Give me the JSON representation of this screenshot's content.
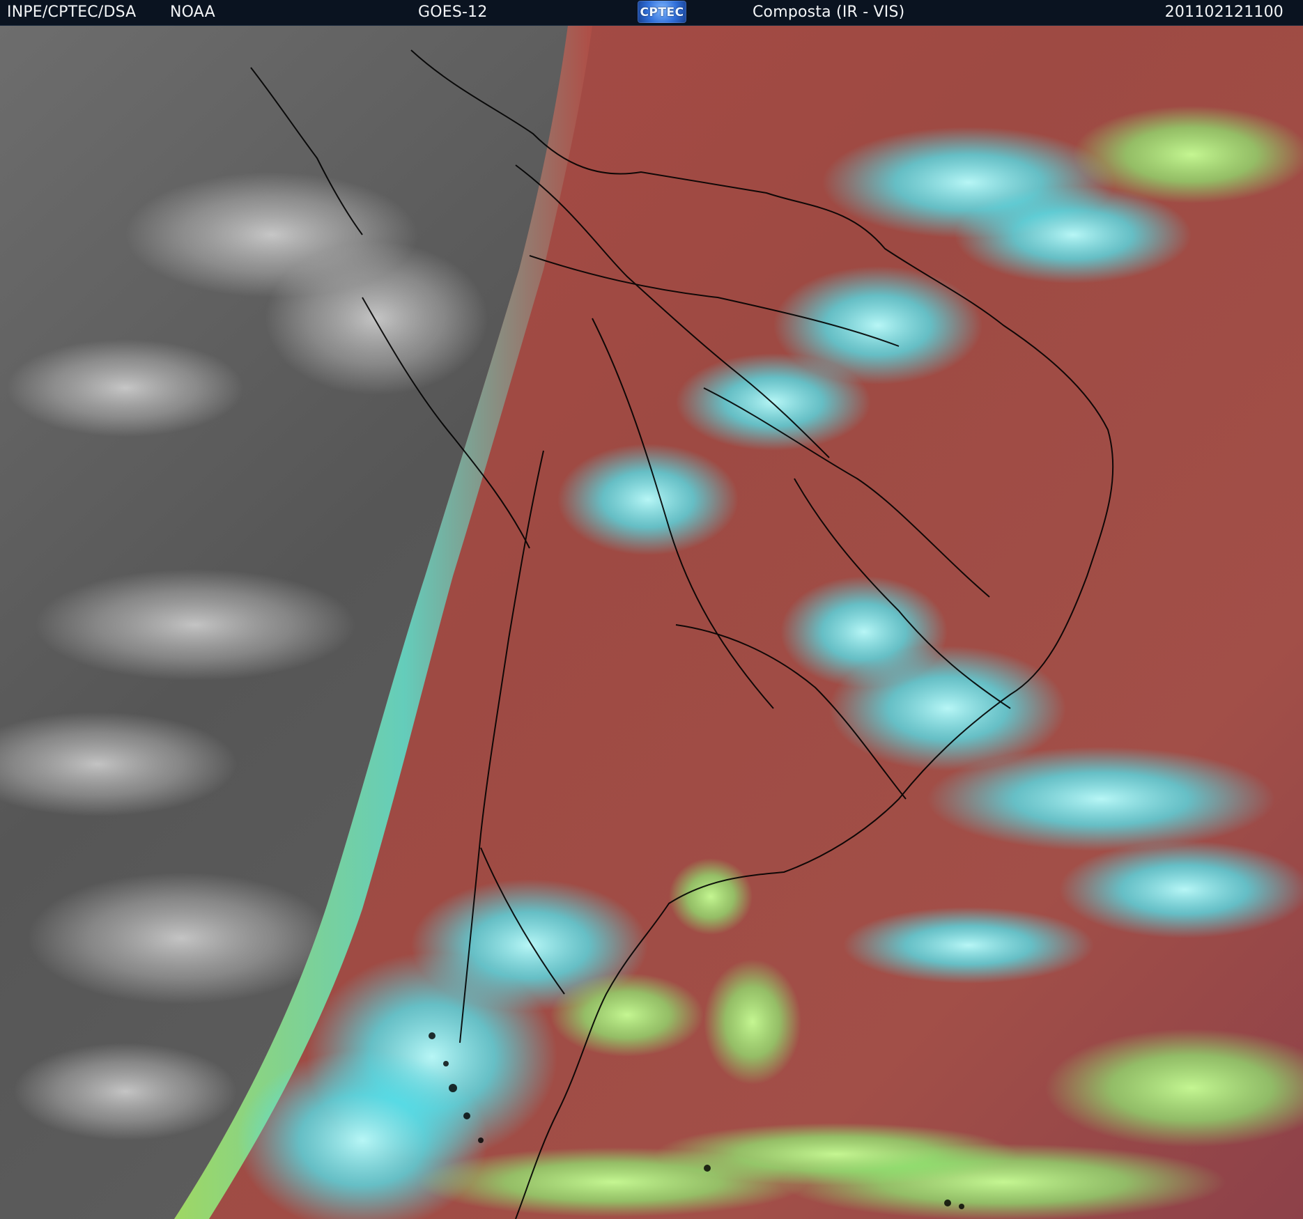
{
  "header": {
    "agency": "INPE/CPTEC/DSA",
    "noaa": "NOAA",
    "satellite": "GOES-12",
    "logo_text": "CPTEC",
    "product": "Composta (IR - VIS)",
    "timestamp": "201102121100"
  },
  "image": {
    "logo_icon": "cptec-logo-icon",
    "colors": {
      "night_gray": "#6d6d6d",
      "ocean_red": "#a34b45",
      "cloud_cyan": "#7de8ee",
      "cloud_green": "#98ef74",
      "land_border": "#000000"
    }
  }
}
